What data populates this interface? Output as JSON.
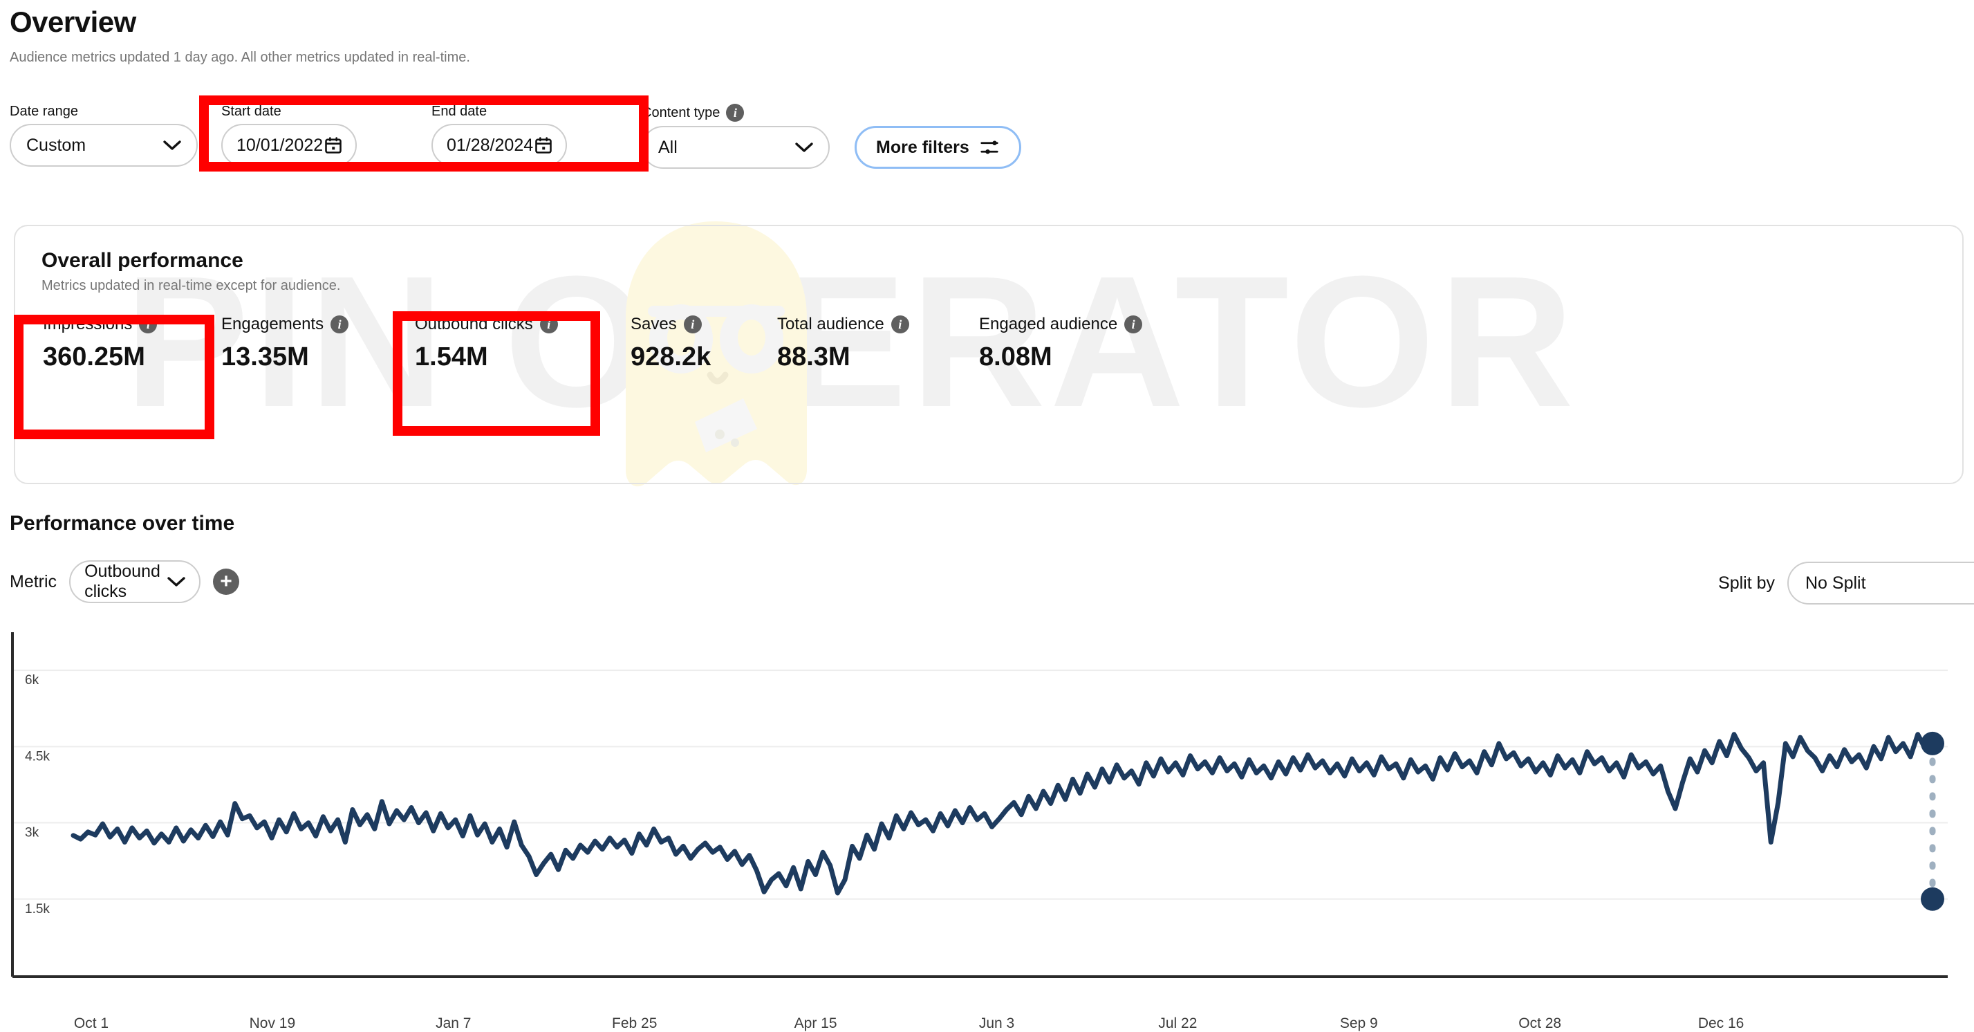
{
  "header": {
    "title": "Overview",
    "subtitle": "Audience metrics updated 1 day ago. All other metrics updated in real-time."
  },
  "filters": {
    "date_range": {
      "label": "Date range",
      "value": "Custom"
    },
    "start_date": {
      "label": "Start date",
      "value": "10/01/2022",
      "icon": "calendar-icon"
    },
    "end_date": {
      "label": "End date",
      "value": "01/28/2024",
      "icon": "calendar-icon"
    },
    "content_type": {
      "label": "Content type",
      "value": "All",
      "info_icon": "info-icon"
    },
    "more_filters": {
      "label": "More filters",
      "icon": "sliders-icon"
    }
  },
  "overall_performance": {
    "title": "Overall performance",
    "subtitle": "Metrics updated in real-time except for audience.",
    "metrics": [
      {
        "label": "Impressions",
        "value": "360.25M",
        "highlighted": true
      },
      {
        "label": "Engagements",
        "value": "13.35M",
        "highlighted": false
      },
      {
        "label": "Outbound clicks",
        "value": "1.54M",
        "highlighted": true
      },
      {
        "label": "Saves",
        "value": "928.2k",
        "highlighted": false
      },
      {
        "label": "Total audience",
        "value": "88.3M",
        "highlighted": false
      },
      {
        "label": "Engaged audience",
        "value": "8.08M",
        "highlighted": false
      }
    ]
  },
  "performance_over_time": {
    "title": "Performance over time",
    "metric_label": "Metric",
    "metric_value": "Outbound clicks",
    "add_metric_label": "+",
    "split_by_label": "Split by",
    "split_by_value": "No Split"
  },
  "watermark": {
    "text": "PIN  OPERATOR"
  },
  "colors": {
    "line": "#1d3b5f",
    "annotation": "#ff0000",
    "focus_ring": "#8fbdf5",
    "grid": "#ededed",
    "axis": "#3d3d3d"
  },
  "chart_data": {
    "type": "line",
    "title": "Performance over time",
    "ylabel": "Outbound clicks",
    "xlabel": "",
    "ylim": [
      0,
      6750
    ],
    "grid": true,
    "legend": false,
    "ytick_labels": [
      "6k",
      "4.5k",
      "3k",
      "1.5k"
    ],
    "ytick_values": [
      6000,
      4500,
      3000,
      1500
    ],
    "xtick_labels": [
      "Oct 1",
      "Nov 19",
      "Jan 7",
      "Feb 25",
      "Apr 15",
      "Jun 3",
      "Jul 22",
      "Sep 9",
      "Oct 28",
      "Dec 16"
    ],
    "series": [
      {
        "name": "Outbound clicks",
        "color": "#1d3b5f",
        "values": [
          2750,
          2680,
          2820,
          2760,
          2980,
          2720,
          2880,
          2620,
          2900,
          2700,
          2840,
          2600,
          2780,
          2620,
          2900,
          2640,
          2860,
          2700,
          2950,
          2730,
          3020,
          2760,
          3380,
          3080,
          3140,
          2900,
          3020,
          2700,
          3060,
          2820,
          3180,
          2880,
          3000,
          2740,
          3120,
          2840,
          3060,
          2620,
          3260,
          2960,
          3160,
          2880,
          3420,
          2980,
          3240,
          3060,
          3300,
          3000,
          3200,
          2840,
          3180,
          2900,
          3060,
          2740,
          3140,
          2760,
          2980,
          2620,
          2880,
          2520,
          3020,
          2560,
          2340,
          1980,
          2200,
          2380,
          2080,
          2460,
          2300,
          2560,
          2420,
          2640,
          2480,
          2700,
          2520,
          2660,
          2400,
          2780,
          2560,
          2880,
          2620,
          2700,
          2380,
          2540,
          2300,
          2480,
          2600,
          2420,
          2520,
          2280,
          2440,
          2180,
          2360,
          2060,
          1640,
          1880,
          2000,
          1760,
          2120,
          1700,
          2240,
          1980,
          2420,
          2160,
          1620,
          1880,
          2540,
          2300,
          2760,
          2480,
          2980,
          2700,
          3140,
          2880,
          3200,
          2960,
          3060,
          2840,
          3180,
          2940,
          3240,
          3000,
          3300,
          3060,
          3180,
          2920,
          3080,
          3260,
          3400,
          3160,
          3520,
          3280,
          3620,
          3380,
          3740,
          3460,
          3860,
          3580,
          3960,
          3700,
          4060,
          3800,
          4140,
          3880,
          4020,
          3760,
          4180,
          3920,
          4260,
          4000,
          4180,
          3940,
          4320,
          4060,
          4200,
          3980,
          4280,
          4020,
          4160,
          3900,
          4240,
          3980,
          4120,
          3880,
          4200,
          3960,
          4280,
          4040,
          4340,
          4080,
          4220,
          3980,
          4160,
          3920,
          4260,
          4020,
          4180,
          3940,
          4300,
          4060,
          4160,
          3880,
          4240,
          4000,
          4120,
          3860,
          4280,
          4040,
          4360,
          4100,
          4220,
          3980,
          4400,
          4140,
          4560,
          4260,
          4380,
          4120,
          4260,
          4000,
          4180,
          3940,
          4320,
          4080,
          4240,
          3980,
          4400,
          4160,
          4280,
          4020,
          4180,
          3900,
          4340,
          4080,
          4200,
          3960,
          4120,
          3620,
          3280,
          3800,
          4260,
          4000,
          4420,
          4180,
          4600,
          4320,
          4740,
          4460,
          4280,
          4020,
          4180,
          2620,
          3400,
          4560,
          4300,
          4680,
          4420,
          4280,
          4020,
          4320,
          4100,
          4440,
          4200,
          4340,
          4080,
          4500,
          4260,
          4680,
          4400,
          4560,
          4300,
          4740,
          4460,
          4620
        ]
      }
    ],
    "end_markers": [
      {
        "name": "series-end-marker",
        "value": 4560
      },
      {
        "name": "baseline-marker",
        "value": 1500
      }
    ],
    "connector": {
      "style": "dashed",
      "color": "#9fb0c0"
    }
  }
}
